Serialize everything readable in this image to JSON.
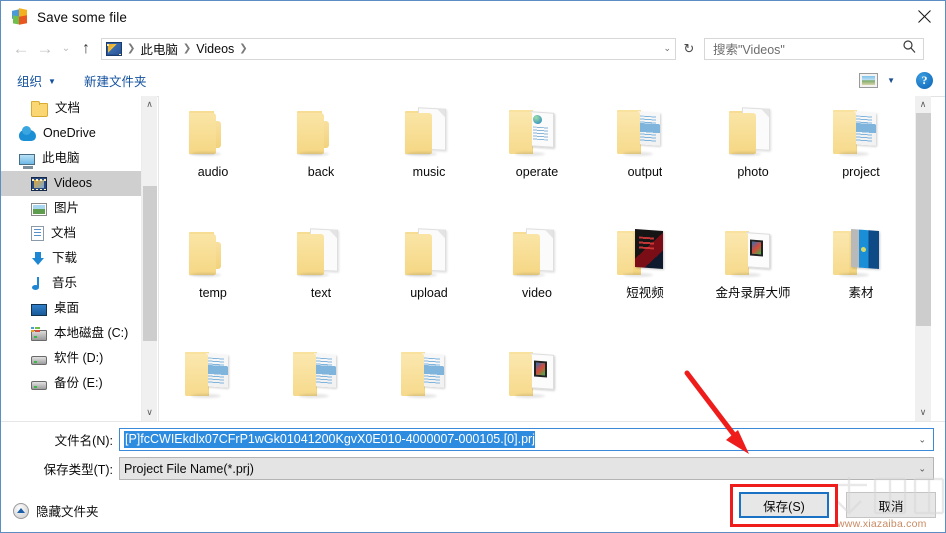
{
  "window": {
    "title": "Save some file",
    "app_icon": "butterfly-logo-icon",
    "close_label": "✕"
  },
  "navbar": {
    "back_icon": "←",
    "forward_icon": "→",
    "recent_icon": "⌄",
    "up_icon": "↑",
    "breadcrumb": {
      "icon": "videos-library-icon",
      "items": [
        "此电脑",
        "Videos"
      ],
      "separator": "❯",
      "dropdown_icon": "⌄"
    },
    "refresh_icon": "↻",
    "search": {
      "placeholder": "搜索\"Videos\"",
      "icon": "search-icon"
    }
  },
  "commandbar": {
    "organize_label": "组织",
    "organize_caret": "▼",
    "new_folder_label": "新建文件夹",
    "view_icon": "view-layout-icon",
    "view_caret": "▼",
    "help_label": "?"
  },
  "nav_pane": {
    "items": [
      {
        "label": "文档",
        "icon": "folder-icon",
        "indent": 1,
        "selected": false
      },
      {
        "label": "OneDrive",
        "icon": "onedrive-icon",
        "indent": 0,
        "selected": false
      },
      {
        "label": "此电脑",
        "icon": "this-pc-icon",
        "indent": 0,
        "selected": false
      },
      {
        "label": "Videos",
        "icon": "videos-icon",
        "indent": 1,
        "selected": true
      },
      {
        "label": "图片",
        "icon": "pictures-icon",
        "indent": 1,
        "selected": false
      },
      {
        "label": "文档",
        "icon": "documents-icon",
        "indent": 1,
        "selected": false
      },
      {
        "label": "下载",
        "icon": "downloads-icon",
        "indent": 1,
        "selected": false
      },
      {
        "label": "音乐",
        "icon": "music-icon",
        "indent": 1,
        "selected": false
      },
      {
        "label": "桌面",
        "icon": "desktop-icon",
        "indent": 1,
        "selected": false
      },
      {
        "label": "本地磁盘 (C:)",
        "icon": "system-drive-icon",
        "indent": 1,
        "selected": false
      },
      {
        "label": "软件 (D:)",
        "icon": "drive-icon",
        "indent": 1,
        "selected": false
      },
      {
        "label": "备份 (E:)",
        "icon": "drive-icon",
        "indent": 1,
        "selected": false
      }
    ],
    "scroll_up_icon": "∧",
    "scroll_down_icon": "∨"
  },
  "file_grid": {
    "items": [
      {
        "label": "audio",
        "art": "plain"
      },
      {
        "label": "back",
        "art": "plain"
      },
      {
        "label": "music",
        "art": "page"
      },
      {
        "label": "operate",
        "art": "web"
      },
      {
        "label": "output",
        "art": "doc"
      },
      {
        "label": "photo",
        "art": "page"
      },
      {
        "label": "project",
        "art": "doc"
      },
      {
        "label": "temp",
        "art": "plain"
      },
      {
        "label": "text",
        "art": "page"
      },
      {
        "label": "upload",
        "art": "page"
      },
      {
        "label": "video",
        "art": "page"
      },
      {
        "label": "短视频",
        "art": "dark"
      },
      {
        "label": "金舟录屏大师",
        "art": "film"
      },
      {
        "label": "素材",
        "art": "win"
      },
      {
        "label": "",
        "art": "doc"
      },
      {
        "label": "",
        "art": "doc"
      },
      {
        "label": "",
        "art": "doc"
      },
      {
        "label": "",
        "art": "film"
      }
    ],
    "scroll_up_icon": "∧",
    "scroll_down_icon": "∨"
  },
  "form": {
    "filename_label": "文件名(N):",
    "filename_value": "[P]fcCWIEkdlx07CFrP1wGk01041200KgvX0E010-4000007-000105.[0].prj",
    "filetype_label": "保存类型(T):",
    "filetype_value": "Project File Name(*.prj)",
    "dropdown_icon": "⌄"
  },
  "footer": {
    "hide_folders_label": "隐藏文件夹",
    "hide_folders_icon": "collapse-up-icon",
    "save_label": "保存(S)",
    "cancel_label": "取消"
  },
  "annotations": {
    "highlight_color": "#ef1c1c",
    "arrow_name": "red-pointer-arrow",
    "rect_name": "red-highlight-rect"
  },
  "watermark": {
    "text": "下载吧",
    "url": "www.xiazaiba.com"
  }
}
